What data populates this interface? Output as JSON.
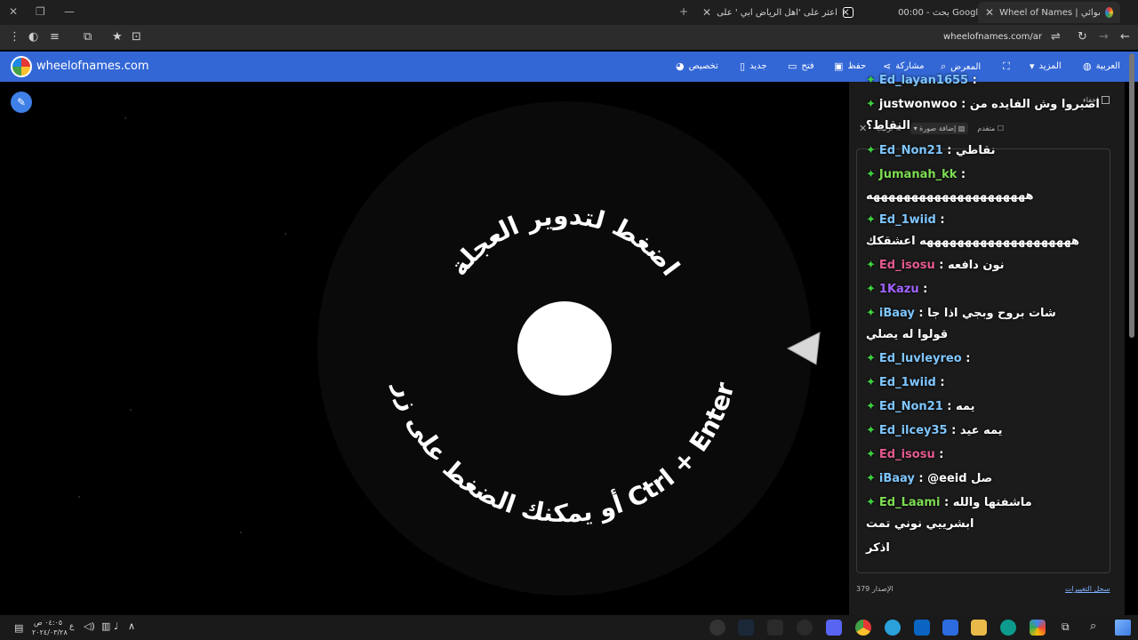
{
  "tabs": [
    {
      "label": "Wheel of Names | اسم العشوائي"
    },
    {
      "label": "00:00 - بحث Google"
    },
    {
      "label": "اعثر على 'اهل الرياض ابي ' على"
    }
  ],
  "address": {
    "url": "wheelofnames.com/ar"
  },
  "site": {
    "brand": "wheelofnames.com",
    "nav": {
      "customize": "تخصيص",
      "new": "جديد",
      "open": "فتح",
      "save": "حفظ",
      "share": "مشاركة",
      "gallery": "المعرض",
      "more": "المزيد",
      "language": "العربية"
    }
  },
  "wheel": {
    "top_text": "اضغط لتدوير العجلة",
    "bottom_text": "أو يمكنك الضغط على زر Ctrl + Enter"
  },
  "panel": {
    "hide_label": "إخفاء",
    "sort_label": "ترتيب",
    "add_image_label": "إضافة صورة",
    "advanced_label": "متقدم",
    "version_label": "الإصدار",
    "version_number": "379",
    "changelog_link": "سجل التغييرات"
  },
  "chat": [
    {
      "user": "Ed_layan1655",
      "text": "",
      "color": "#7fc6ff"
    },
    {
      "user": "justwonwoo",
      "text": "اصبروا وش الفايده من",
      "color": "#ffffff"
    },
    {
      "user": "",
      "text": "النقاط؟",
      "color": "#ffffff"
    },
    {
      "user": "Ed_Non21",
      "text": "نقاطي",
      "color": "#7fc6ff"
    },
    {
      "user": "Jumanah_kk",
      "text": "",
      "color": "#7ddc52"
    },
    {
      "user": "",
      "text": "هههههههههههههههههههههه",
      "color": "#ffffff"
    },
    {
      "user": "Ed_1wiid",
      "text": "",
      "color": "#7fc6ff"
    },
    {
      "user": "",
      "text": "ههههههههههههههههههههه اعشقكك",
      "color": "#ffffff"
    },
    {
      "user": "Ed_isosu",
      "text": "نون دافعه",
      "color": "#e35a8f"
    },
    {
      "user": "1Kazu",
      "text": "",
      "color": "#a063ff"
    },
    {
      "user": "iBaay",
      "text": "شات بروح وبجي اذا جا",
      "color": "#7fc6ff"
    },
    {
      "user": "",
      "text": "قولوا له يصلي",
      "color": "#ffffff"
    },
    {
      "user": "Ed_luvleyreo",
      "text": "",
      "color": "#7fc6ff"
    },
    {
      "user": "Ed_1wiid",
      "text": "",
      "color": "#7fc6ff"
    },
    {
      "user": "Ed_Non21",
      "text": "يمه",
      "color": "#7fc6ff"
    },
    {
      "user": "Ed_ilcey35",
      "text": "يمه عيد",
      "color": "#7fc6ff"
    },
    {
      "user": "Ed_isosu",
      "text": "",
      "color": "#e35a8f"
    },
    {
      "user": "iBaay",
      "text": "@eeid صل",
      "color": "#7fc6ff"
    },
    {
      "user": "Ed_Laami",
      "text": "ماشفتها والله",
      "color": "#7ddc52"
    },
    {
      "user": "",
      "text": "ابشرييي نوني تمت",
      "color": "#ffffff"
    },
    {
      "user": "",
      "text": "اذكر",
      "color": "#ffffff"
    }
  ],
  "taskbar": {
    "time": "٠٤:٠٥ ص",
    "date": "٢٠٢٤/٠٣/٢٨",
    "lang": "ع"
  }
}
